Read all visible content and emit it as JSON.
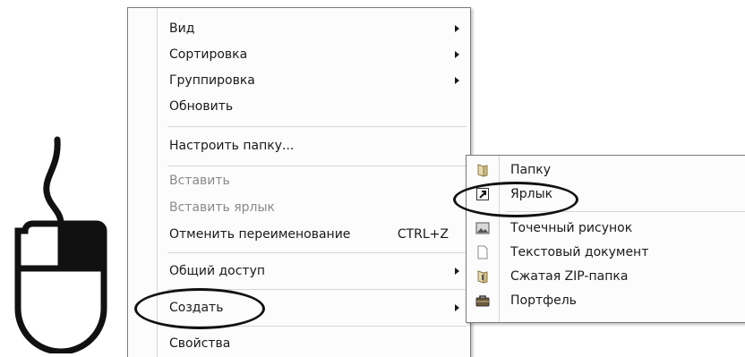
{
  "context_menu": {
    "items": [
      {
        "label": "Вид",
        "submenu": true
      },
      {
        "label": "Сортировка",
        "submenu": true
      },
      {
        "label": "Группировка",
        "submenu": true
      },
      {
        "label": "Обновить"
      },
      {
        "label": "Настроить папку..."
      },
      {
        "label": "Вставить",
        "disabled": true
      },
      {
        "label": "Вставить ярлык",
        "disabled": true
      },
      {
        "label": "Отменить переименование",
        "shortcut": "CTRL+Z"
      },
      {
        "label": "Общий доступ",
        "submenu": true
      },
      {
        "label": "Создать",
        "submenu": true,
        "highlighted": true
      },
      {
        "label": "Свойства"
      }
    ]
  },
  "create_submenu": {
    "items": [
      {
        "label": "Папку",
        "icon": "folder-icon"
      },
      {
        "label": "Ярлык",
        "icon": "shortcut-icon",
        "highlighted": true
      },
      {
        "label": "Точечный рисунок",
        "icon": "bitmap-image-icon"
      },
      {
        "label": "Текстовый документ",
        "icon": "text-document-icon"
      },
      {
        "label": "Сжатая ZIP-папка",
        "icon": "zip-folder-icon"
      },
      {
        "label": "Портфель",
        "icon": "briefcase-icon"
      }
    ]
  },
  "illustration": {
    "icon": "mouse-right-click-icon"
  }
}
